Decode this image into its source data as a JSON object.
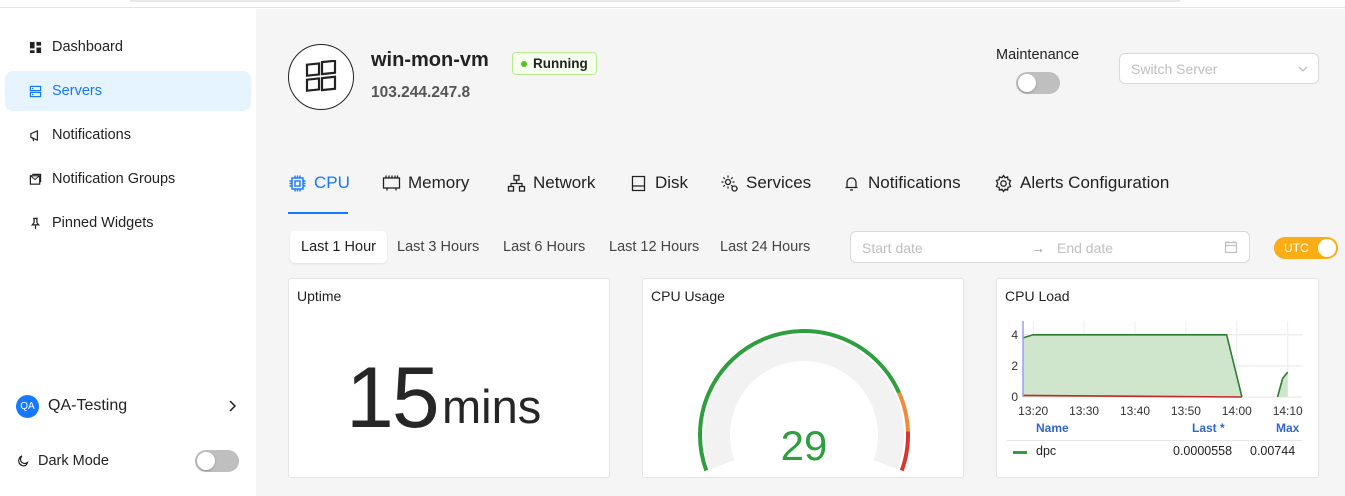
{
  "sidebar": {
    "items": [
      {
        "label": "Dashboard",
        "icon": "dashboard-icon",
        "active": false
      },
      {
        "label": "Servers",
        "icon": "servers-icon",
        "active": true
      },
      {
        "label": "Notifications",
        "icon": "megaphone-icon",
        "active": false
      },
      {
        "label": "Notification Groups",
        "icon": "notification-groups-icon",
        "active": false
      },
      {
        "label": "Pinned Widgets",
        "icon": "pin-icon",
        "active": false
      }
    ],
    "user": {
      "initials": "QA",
      "name": "QA-Testing"
    },
    "dark_mode_label": "Dark Mode",
    "dark_mode_on": false
  },
  "server": {
    "name": "win-mon-vm",
    "status": "Running",
    "ip": "103.244.247.8",
    "maintenance_label": "Maintenance",
    "maintenance_on": false,
    "switch_placeholder": "Switch Server"
  },
  "tabs": [
    {
      "label": "CPU",
      "icon": "cpu-icon",
      "active": true
    },
    {
      "label": "Memory",
      "icon": "memory-icon",
      "active": false
    },
    {
      "label": "Network",
      "icon": "network-icon",
      "active": false
    },
    {
      "label": "Disk",
      "icon": "disk-icon",
      "active": false
    },
    {
      "label": "Services",
      "icon": "services-gear-icon",
      "active": false
    },
    {
      "label": "Notifications",
      "icon": "bell-icon",
      "active": false
    },
    {
      "label": "Alerts Configuration",
      "icon": "gear-icon",
      "active": false
    }
  ],
  "time_ranges": [
    {
      "label": "Last 1 Hour",
      "active": true
    },
    {
      "label": "Last 3 Hours",
      "active": false
    },
    {
      "label": "Last 6 Hours",
      "active": false
    },
    {
      "label": "Last 12 Hours",
      "active": false
    },
    {
      "label": "Last 24 Hours",
      "active": false
    }
  ],
  "date_range": {
    "start_placeholder": "Start date",
    "arrow": "→",
    "end_placeholder": "End date"
  },
  "utc": {
    "label": "UTC",
    "on": true
  },
  "cards": {
    "uptime": {
      "title": "Uptime",
      "value": "15",
      "unit": "mins"
    },
    "cpu_usage": {
      "title": "CPU Usage",
      "value": "29"
    },
    "cpu_load": {
      "title": "CPU Load",
      "legend_headers": {
        "name": "Name",
        "last": "Last *",
        "max": "Max"
      },
      "legend_rows": [
        {
          "name": "dpc",
          "last": "0.0000558",
          "max": "0.00744"
        }
      ]
    }
  },
  "colors": {
    "accent": "#1677ff",
    "running": "#52c41a",
    "utc": "#faad14",
    "gauge_green": "#2e9e3e",
    "gauge_orange": "#f08c3a",
    "gauge_red": "#d7372e"
  },
  "chart_data": [
    {
      "type": "gauge",
      "title": "CPU Usage",
      "value": 29,
      "min": 0,
      "max": 100,
      "bands": [
        {
          "from": 0,
          "to": 80,
          "color": "#2e9e3e"
        },
        {
          "from": 80,
          "to": 90,
          "color": "#f08c3a"
        },
        {
          "from": 90,
          "to": 100,
          "color": "#d7372e"
        }
      ]
    },
    {
      "type": "area",
      "title": "CPU Load",
      "x_ticks": [
        "13:20",
        "13:30",
        "13:40",
        "13:50",
        "14:00",
        "14:10"
      ],
      "y_ticks": [
        0,
        2,
        4
      ],
      "ylim": [
        0,
        4.5
      ],
      "series": [
        {
          "name": "",
          "color": "#2e7d32",
          "fill": "#cfe6cc",
          "points": [
            [
              "13:18",
              3.8
            ],
            [
              "13:20",
              4.0
            ],
            [
              "13:58",
              4.0
            ],
            [
              "14:01",
              0.0
            ]
          ],
          "points2": [
            [
              "14:08",
              0.0
            ],
            [
              "14:09",
              1.2
            ],
            [
              "14:10",
              1.6
            ]
          ]
        },
        {
          "name": "dpc",
          "color": "#c62828",
          "points": [
            [
              "13:18",
              0.1
            ],
            [
              "14:01",
              0.0
            ]
          ]
        }
      ],
      "grid": true
    }
  ]
}
